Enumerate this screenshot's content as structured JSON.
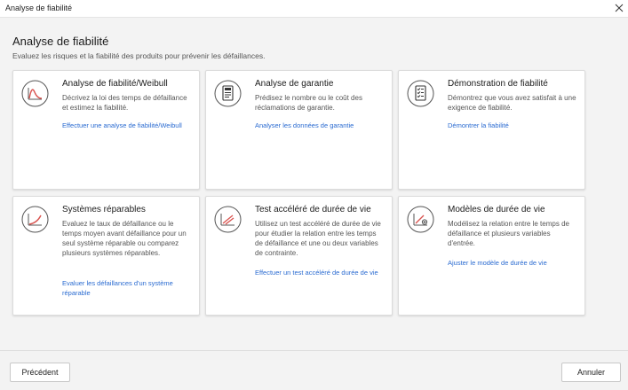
{
  "window": {
    "title": "Analyse de fiabilité"
  },
  "header": {
    "title": "Analyse de fiabilité",
    "subtitle": "Evaluez les risques et la fiabilité des produits pour prévenir les défaillances."
  },
  "cards": [
    {
      "title": "Analyse de fiabilité/Weibull",
      "description": "Décrivez la loi des temps de défaillance et estimez la fiabilité.",
      "link": "Effectuer une analyse de fiabilité/Weibull",
      "icon": "weibull-distribution-icon"
    },
    {
      "title": "Analyse de garantie",
      "description": "Prédisez le nombre ou le coût des réclamations de garantie.",
      "link": "Analyser les données de garantie",
      "icon": "warranty-document-icon"
    },
    {
      "title": "Démonstration de fiabilité",
      "description": "Démontrez que vous avez satisfait à une exigence de fiabilité.",
      "link": "Démontrer la fiabilité",
      "icon": "checklist-document-icon"
    },
    {
      "title": "Systèmes réparables",
      "description": "Evaluez le taux de défaillance ou le temps moyen avant défaillance pour un seul système réparable ou comparez plusieurs systèmes réparables.",
      "link": "Evaluer les défaillances d'un système réparable",
      "icon": "repairable-curve-icon"
    },
    {
      "title": "Test accéléré de durée de vie",
      "description": "Utilisez un test accéléré de durée de vie pour étudier la relation entre les temps de défaillance et une ou deux variables de contrainte.",
      "link": "Effectuer un test accéléré de durée de vie",
      "icon": "accelerated-test-icon"
    },
    {
      "title": "Modèles de durée de vie",
      "description": "Modélisez la relation entre le temps de défaillance et plusieurs variables d'entrée.",
      "link": "Ajuster le modèle de durée de vie",
      "icon": "lifetime-model-icon"
    }
  ],
  "footer": {
    "previous_label": "Précédent",
    "cancel_label": "Annuler"
  },
  "colors": {
    "accent": "#2a6bd1",
    "icon_stroke": "#555555",
    "icon_accent": "#d9534f"
  }
}
